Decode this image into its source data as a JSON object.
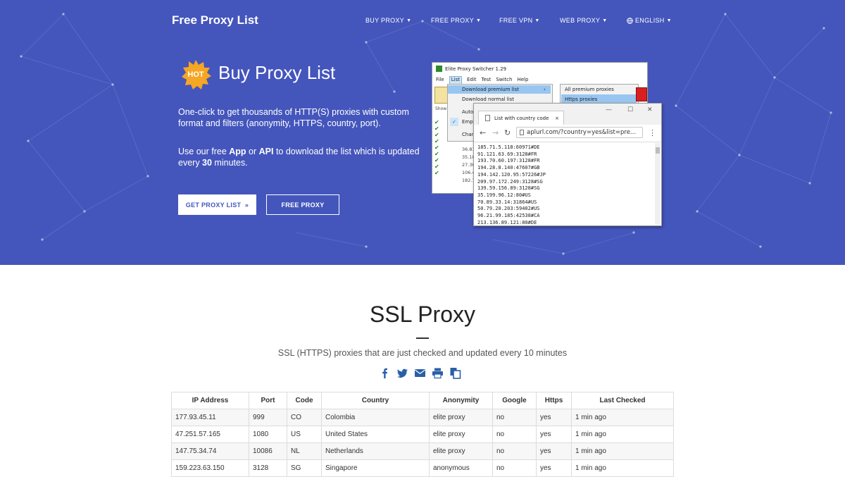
{
  "header": {
    "brand": "Free Proxy List",
    "nav": [
      {
        "label": "BUY PROXY"
      },
      {
        "label": "FREE PROXY"
      },
      {
        "label": "FREE VPN"
      },
      {
        "label": "WEB PROXY"
      },
      {
        "label": "ENGLISH"
      }
    ]
  },
  "hero": {
    "badge": "HOT",
    "title": "Buy Proxy List",
    "desc": "One-click to get thousands of HTTP(S) proxies with custom format and filters (anonymity, HTTPS, country, port).",
    "desc2_pre": "Use our free ",
    "desc2_app": "App",
    "desc2_or": " or ",
    "desc2_api": "API",
    "desc2_mid": " to download the list which is updated every ",
    "desc2_num": "30",
    "desc2_end": " minutes.",
    "btn_get": "GET PROXY LIST",
    "btn_get_arrow": "»",
    "btn_free": "FREE PROXY"
  },
  "app": {
    "title": "Elite Proxy Switcher 1.29",
    "menu": [
      "File",
      "List",
      "Edit",
      "Test",
      "Switch",
      "Help"
    ],
    "dropdown": [
      "Download premium list",
      "Download normal list",
      "Auto",
      "Empt",
      "Chan"
    ],
    "submenu": [
      "All premium proxies",
      "Https proxies"
    ],
    "side_label": "Show",
    "left_nums": [
      "36.81",
      "35.18",
      "27.36",
      "106.4",
      "182.1"
    ],
    "browser_tab": "List with country code",
    "tab_close": "×",
    "url": "aplurl.com/?country=yes&list=pre...",
    "proxies": [
      "185.71.5.118:60971#DE",
      "91.121.63.69:3128#FR",
      "193.70.60.197:3128#FR",
      "194.28.8.140:47607#GB",
      "194.142.120.95:57226#JP",
      "209.97.172.249:3128#SG",
      "139.59.156.89:3128#SG",
      "35.199.96.12:80#US",
      "70.89.33.14:31864#US",
      "50.79.20.203:59402#US",
      "96.21.99.185:42538#CA",
      "213.136.89.121:80#DE"
    ]
  },
  "section": {
    "title": "SSL Proxy",
    "subtitle": "SSL (HTTPS) proxies that are just checked and updated every 10 minutes"
  },
  "share_icons": [
    "facebook-icon",
    "twitter-icon",
    "email-icon",
    "print-icon",
    "copy-icon"
  ],
  "table": {
    "headers": [
      "IP Address",
      "Port",
      "Code",
      "Country",
      "Anonymity",
      "Google",
      "Https",
      "Last Checked"
    ],
    "rows": [
      [
        "177.93.45.11",
        "999",
        "CO",
        "Colombia",
        "elite proxy",
        "no",
        "yes",
        "1 min ago"
      ],
      [
        "47.251.57.165",
        "1080",
        "US",
        "United States",
        "elite proxy",
        "no",
        "yes",
        "1 min ago"
      ],
      [
        "147.75.34.74",
        "10086",
        "NL",
        "Netherlands",
        "elite proxy",
        "no",
        "yes",
        "1 min ago"
      ],
      [
        "159.223.63.150",
        "3128",
        "SG",
        "Singapore",
        "anonymous",
        "no",
        "yes",
        "1 min ago"
      ]
    ]
  },
  "colors": {
    "hero_bg": "#4456bc",
    "badge": "#f5a623",
    "accent_white": "#ffffff"
  }
}
